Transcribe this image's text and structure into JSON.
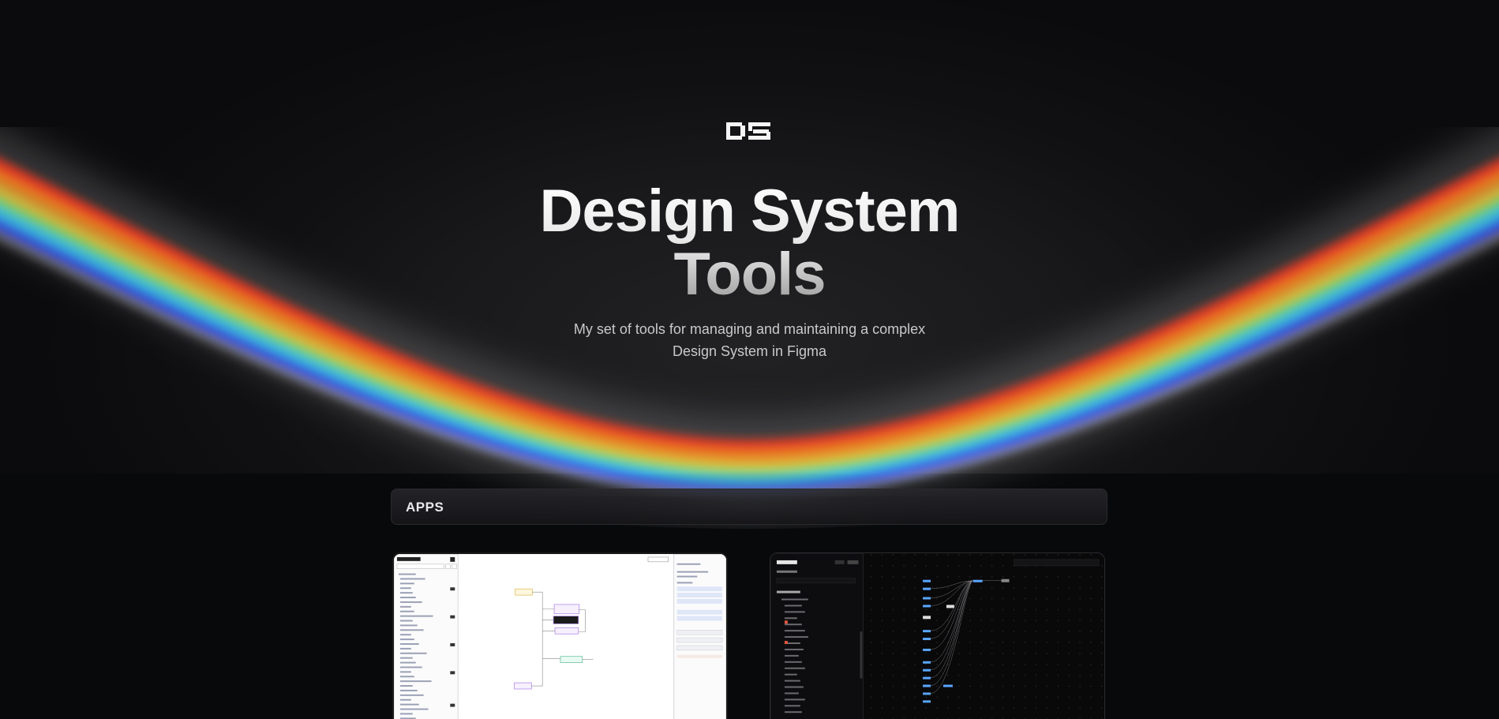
{
  "hero": {
    "logo_icon": "ds-logo-icon",
    "title_line1": "Design System",
    "title_line2": "Tools",
    "subtitle_line1": "My set of tools for managing and maintaining a complex",
    "subtitle_line2": "Design System in Figma"
  },
  "apps_section": {
    "label": "APPS"
  },
  "apps": [
    {
      "name": "app-card-1",
      "screenshot_theme": "light"
    },
    {
      "name": "app-card-2",
      "screenshot_theme": "dark"
    }
  ],
  "colors": {
    "background": "#0c0c0e",
    "title": "#f2f2f2",
    "subtitle": "#c9c9cc",
    "rainbow": [
      "#ff3b1e",
      "#ff8a1f",
      "#ffd23a",
      "#7dff6a",
      "#3ad6ff",
      "#3a5bff",
      "#e8e8f0"
    ]
  }
}
